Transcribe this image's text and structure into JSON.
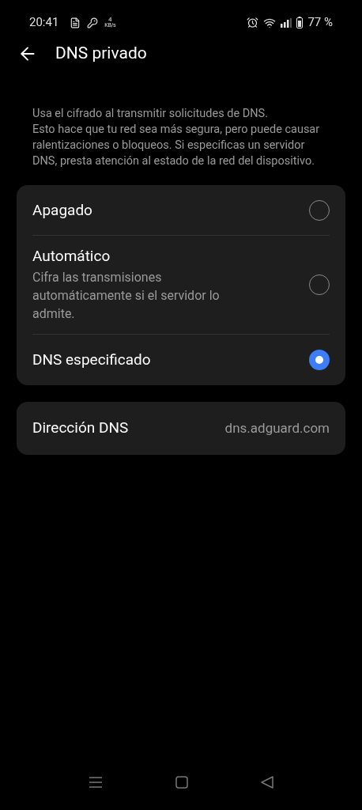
{
  "status_bar": {
    "time": "20:41",
    "speed_value": "4",
    "speed_unit": "KB/s",
    "battery": "77 %"
  },
  "header": {
    "title": "DNS privado"
  },
  "description": "Usa el cifrado al transmitir solicitudes de DNS.\nEsto hace que tu red sea más segura, pero puede causar ralentizaciones o bloqueos. Si especificas un servidor DNS, presta atención al estado de la red del dispositivo.",
  "options": [
    {
      "label": "Apagado",
      "selected": false
    },
    {
      "label": "Automático",
      "subtitle": "Cifra las transmisiones automáticamente si el servidor lo admite.",
      "selected": false
    },
    {
      "label": "DNS especificado",
      "selected": true
    }
  ],
  "dns_address": {
    "label": "Dirección DNS",
    "value": "dns.adguard.com"
  }
}
